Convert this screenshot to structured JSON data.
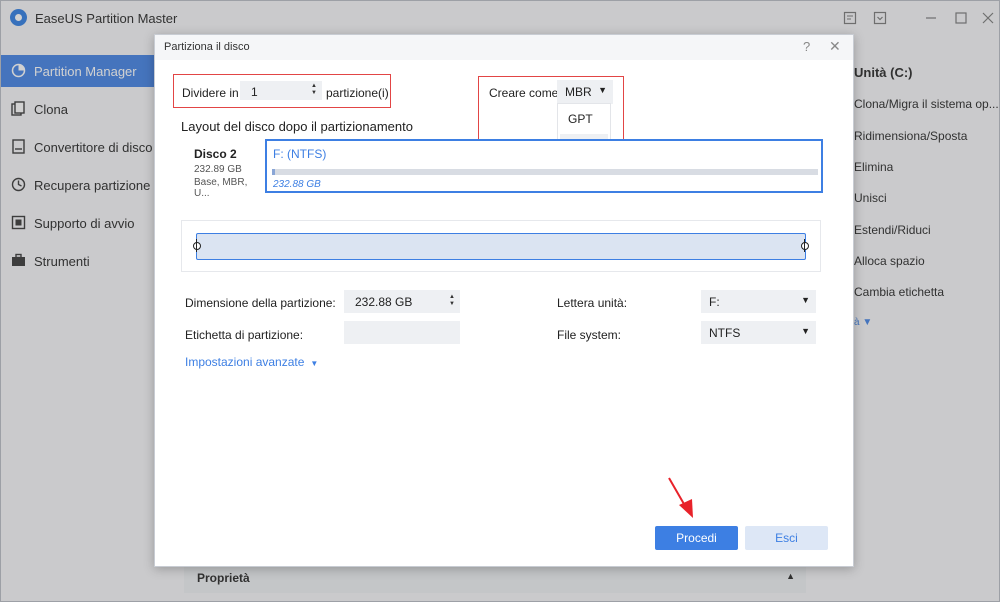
{
  "app": {
    "title": "EaseUS Partition Master"
  },
  "titlebar_icons": [
    "feedback-icon",
    "download-icon",
    "minimize-icon",
    "maximize-icon",
    "close-icon"
  ],
  "sidebar": {
    "items": [
      {
        "label": "Partition Manager",
        "icon": "pie-chart-icon",
        "active": true
      },
      {
        "label": "Clona",
        "icon": "clone-icon",
        "active": false
      },
      {
        "label": "Convertitore di disco",
        "icon": "disk-convert-icon",
        "active": false
      },
      {
        "label": "Recupera partizione",
        "icon": "recover-icon",
        "active": false
      },
      {
        "label": "Supporto di avvio",
        "icon": "boot-media-icon",
        "active": false
      },
      {
        "label": "Strumenti",
        "icon": "toolbox-icon",
        "active": false
      }
    ]
  },
  "right_panel": {
    "title": "Unità (C:)",
    "items": [
      "Clona/Migra il sistema op...",
      "Ridimensiona/Sposta",
      "Elimina",
      "Unisci",
      "Estendi/Riduci",
      "Alloca spazio",
      "Cambia etichetta"
    ],
    "more": "à ▼"
  },
  "properties": {
    "label": "Proprietà",
    "arrow": "▲"
  },
  "dialog": {
    "title": "Partiziona il disco",
    "help": "?",
    "close": "✕",
    "divide_label": "Dividere in",
    "divide_value": "1",
    "divide_suffix": "partizione(i)",
    "create_as_label": "Creare come",
    "create_as_value": "MBR",
    "create_as_options": [
      "GPT",
      "MBR"
    ],
    "layout_label": "Layout del disco dopo il partizionamento",
    "disk": {
      "name": "Disco 2",
      "size": "232.89 GB",
      "info": "Base, MBR, U..."
    },
    "partition": {
      "name": "F: (NTFS)",
      "size": "232.88 GB",
      "used_fraction": 0.005
    },
    "fields": {
      "partition_size_label": "Dimensione della partizione:",
      "partition_size_value": "232.88 GB",
      "partition_label_label": "Etichetta di partizione:",
      "partition_label_value": "",
      "drive_letter_label": "Lettera unità:",
      "drive_letter_value": "F:",
      "filesystem_label": "File system:",
      "filesystem_value": "NTFS"
    },
    "advanced": "Impostazioni avanzate",
    "buttons": {
      "proceed": "Procedi",
      "exit": "Esci"
    }
  },
  "colors": {
    "accent": "#3d7fe3",
    "highlight_box": "#e24545",
    "arrow": "#e8222a"
  }
}
